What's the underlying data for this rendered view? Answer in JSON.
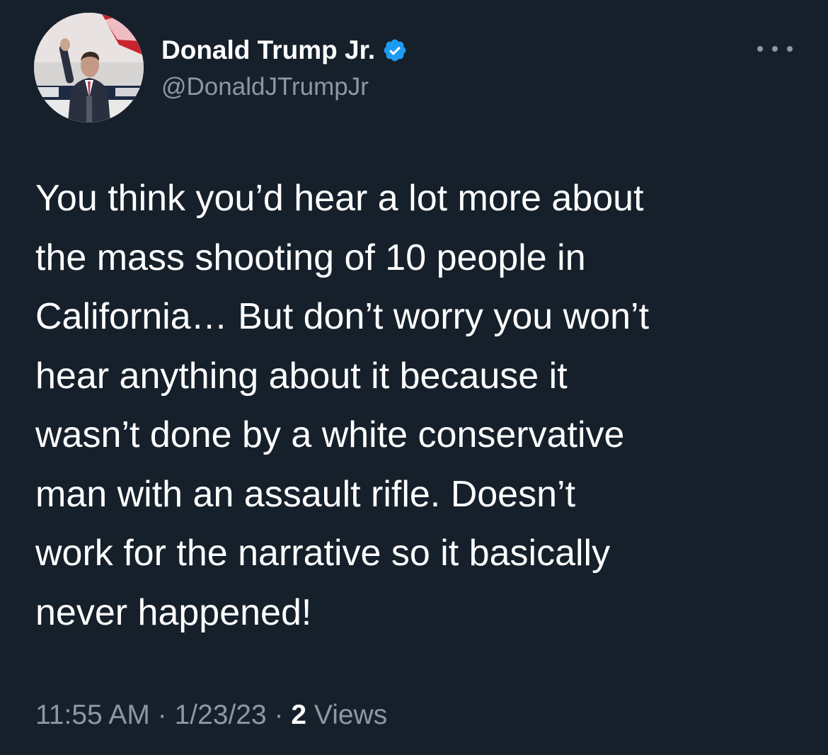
{
  "author": {
    "display_name": "Donald Trump Jr.",
    "handle": "@DonaldJTrumpJr",
    "verified": true,
    "verified_badge_color": "#1d9bf0"
  },
  "menu": {
    "icon": "more-horizontal-icon"
  },
  "tweet": {
    "lines": [
      "You think you’d hear a lot more about",
      "the mass shooting of 10 people in",
      "California… But don’t worry you won’t",
      "hear anything about it because it",
      "wasn’t done by a white conservative",
      "man with an assault rifle. Doesn’t",
      "work for the narrative so it basically",
      "never happened!"
    ]
  },
  "meta": {
    "time": "11:55 AM",
    "separator": " · ",
    "date": "1/23/23",
    "views_count": "2",
    "views_label": " Views"
  },
  "colors": {
    "background": "#15202b",
    "primary_text": "#ffffff",
    "secondary_text": "#8b98a5"
  }
}
